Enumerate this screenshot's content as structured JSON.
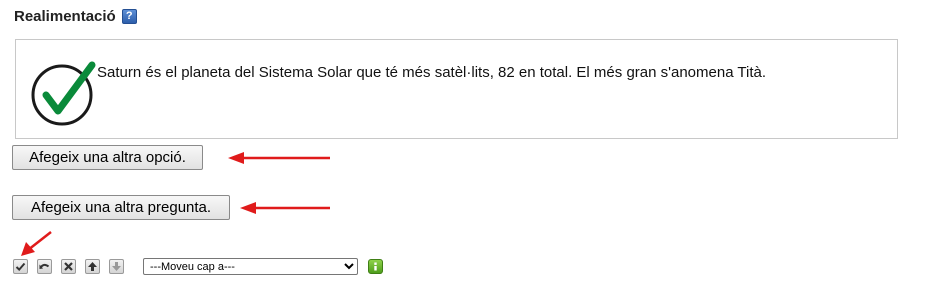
{
  "feedback": {
    "title": "Realimentació",
    "help_icon": "help-icon",
    "help_glyph": "?",
    "icon": "check-circle-icon",
    "text": "Saturn és el planeta del Sistema Solar que té més satèl·lits, 82 en total. El més gran s'anomena Tità.",
    "check_color": "#0a8a3a"
  },
  "actions": {
    "add_option_label": "Afegeix una altra opció.",
    "add_question_label": "Afegeix una altra pregunta."
  },
  "toolbar": {
    "icons": [
      "check-icon",
      "undo-icon",
      "delete-icon",
      "move-up-icon",
      "move-down-icon"
    ],
    "move_select": {
      "selected": "---Moveu cap a---",
      "options": [
        "---Moveu cap a---"
      ]
    },
    "go_icon": "go-icon"
  },
  "annotation_color": "#e01b1b"
}
